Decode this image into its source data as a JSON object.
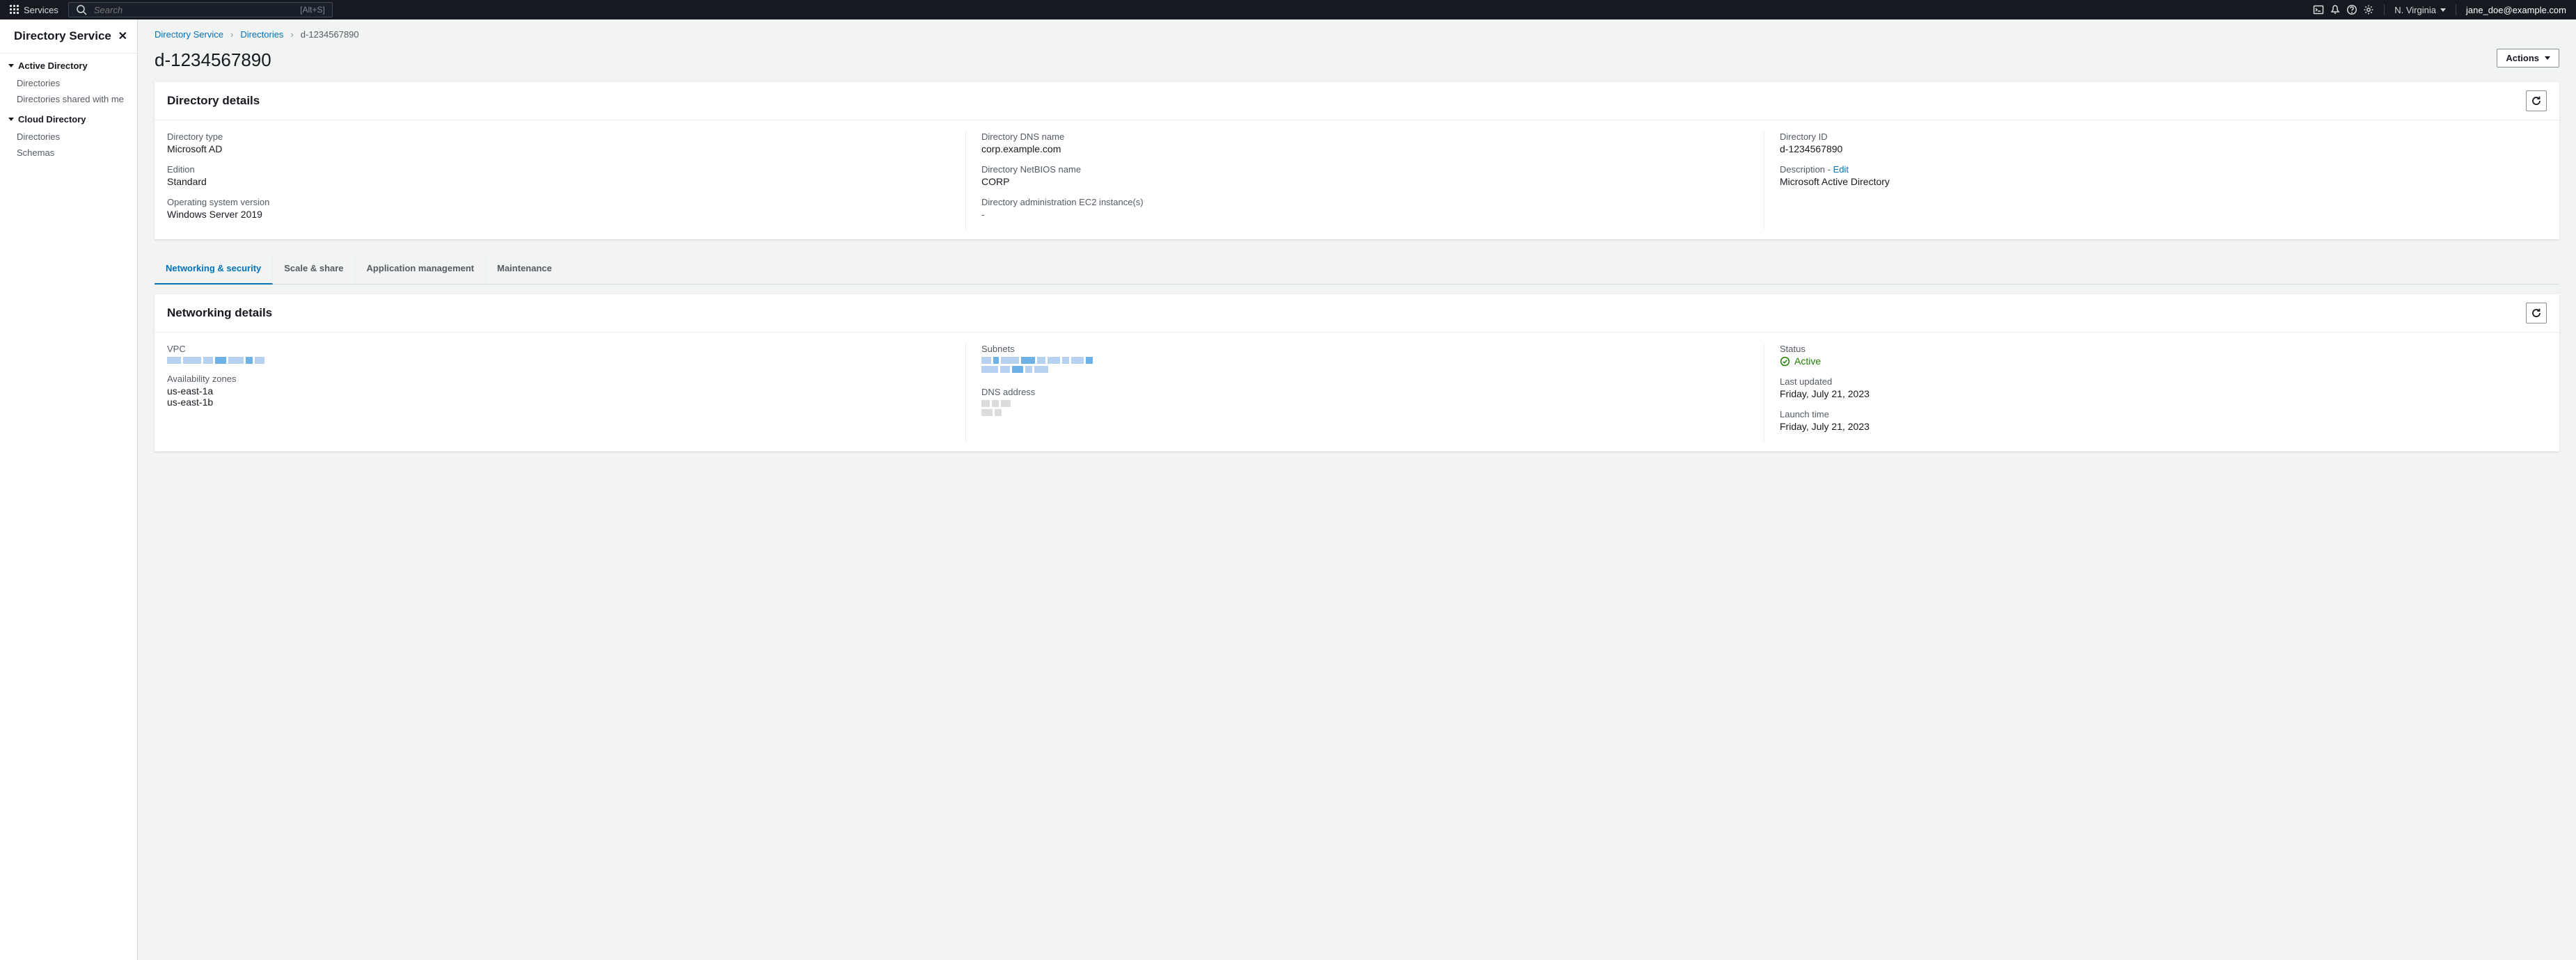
{
  "topbar": {
    "services_label": "Services",
    "search_placeholder": "Search",
    "search_shortcut": "[Alt+S]",
    "region": "N. Virginia",
    "user": "jane_doe@example.com"
  },
  "sidebar": {
    "title": "Directory Service",
    "groups": [
      {
        "label": "Active Directory",
        "items": [
          {
            "label": "Directories"
          },
          {
            "label": "Directories shared with me"
          }
        ]
      },
      {
        "label": "Cloud Directory",
        "items": [
          {
            "label": "Directories"
          },
          {
            "label": "Schemas"
          }
        ]
      }
    ]
  },
  "breadcrumbs": {
    "root": "Directory Service",
    "mid": "Directories",
    "current": "d-1234567890"
  },
  "page": {
    "title": "d-1234567890",
    "actions_label": "Actions"
  },
  "directory_details": {
    "panel_title": "Directory details",
    "col1": {
      "type_k": "Directory type",
      "type_v": "Microsoft AD",
      "edition_k": "Edition",
      "edition_v": "Standard",
      "os_k": "Operating system version",
      "os_v": "Windows Server 2019"
    },
    "col2": {
      "dns_k": "Directory DNS name",
      "dns_v": "corp.example.com",
      "nb_k": "Directory NetBIOS name",
      "nb_v": "CORP",
      "admin_k": "Directory administration EC2 instance(s)",
      "admin_v": "-"
    },
    "col3": {
      "id_k": "Directory ID",
      "id_v": "d-1234567890",
      "desc_k": "Description",
      "desc_sep": " - ",
      "desc_edit": "Edit",
      "desc_v": "Microsoft Active Directory"
    }
  },
  "tabs": {
    "t0": "Networking & security",
    "t1": "Scale & share",
    "t2": "Application management",
    "t3": "Maintenance"
  },
  "networking": {
    "panel_title": "Networking details",
    "vpc_k": "VPC",
    "az_k": "Availability zones",
    "az_v1": "us-east-1a",
    "az_v2": "us-east-1b",
    "subnets_k": "Subnets",
    "dns_k": "DNS address",
    "status_k": "Status",
    "status_v": "Active",
    "updated_k": "Last updated",
    "updated_v": "Friday, July 21, 2023",
    "launch_k": "Launch time",
    "launch_v": "Friday, July 21, 2023"
  }
}
